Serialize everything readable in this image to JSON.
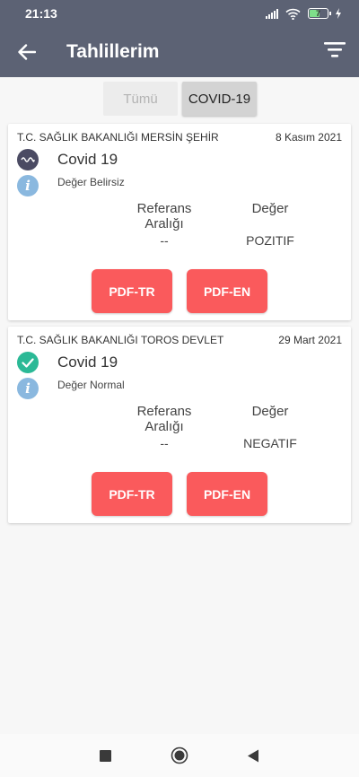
{
  "status_bar": {
    "time": "21:13",
    "battery_level": "7",
    "icons": [
      "signal-icon",
      "wifi-icon",
      "battery-icon",
      "charging-icon"
    ]
  },
  "app_bar": {
    "title": "Tahlillerim",
    "back_icon": "arrow-back-icon",
    "filter_icon": "filter-icon"
  },
  "tabs": [
    {
      "label": "Tümü",
      "active": false
    },
    {
      "label": "COVID-19",
      "active": true
    }
  ],
  "results": [
    {
      "institution": "T.C. SAĞLIK BAKANLIĞI MERSİN ŞEHİR",
      "date": "8 Kasım 2021",
      "status_icon": "wave-icon",
      "test_name": "Covid 19",
      "note": "Değer Belirsiz",
      "ref_header": "Referans Aralığı",
      "value_header": "Değer",
      "ref_value": "--",
      "value": "POZITIF",
      "pdf_tr": "PDF-TR",
      "pdf_en": "PDF-EN"
    },
    {
      "institution": "T.C. SAĞLIK BAKANLIĞI TOROS DEVLET",
      "date": "29 Mart 2021",
      "status_icon": "check-icon",
      "test_name": "Covid 19",
      "note": "Değer Normal",
      "ref_header": "Referans Aralığı",
      "value_header": "Değer",
      "ref_value": "--",
      "value": "NEGATIF",
      "pdf_tr": "PDF-TR",
      "pdf_en": "PDF-EN"
    }
  ],
  "colors": {
    "app_bar": "#5c6274",
    "button": "#fa5a5c",
    "status_wave": "#4b4b63",
    "status_ok": "#2bb996",
    "info": "#8ab8df"
  }
}
